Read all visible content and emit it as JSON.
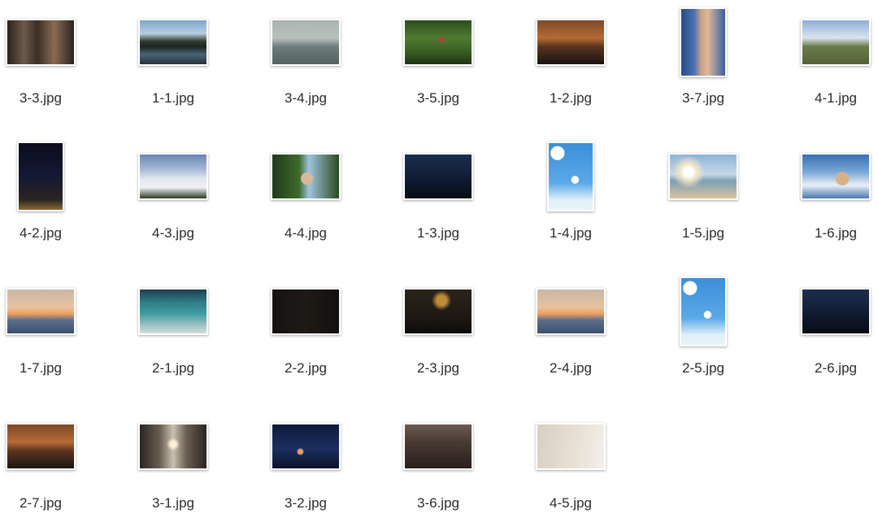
{
  "files": [
    {
      "name": "3-3.jpg",
      "icon": "photo-icon"
    },
    {
      "name": "1-1.jpg",
      "icon": "photo-icon"
    },
    {
      "name": "3-4.jpg",
      "icon": "photo-icon"
    },
    {
      "name": "3-5.jpg",
      "icon": "photo-icon"
    },
    {
      "name": "1-2.jpg",
      "icon": "photo-icon"
    },
    {
      "name": "3-7.jpg",
      "icon": "photo-icon"
    },
    {
      "name": "4-1.jpg",
      "icon": "photo-icon"
    },
    {
      "name": "4-2.jpg",
      "icon": "photo-icon"
    },
    {
      "name": "4-3.jpg",
      "icon": "photo-icon"
    },
    {
      "name": "4-4.jpg",
      "icon": "photo-icon"
    },
    {
      "name": "1-3.jpg",
      "icon": "photo-icon"
    },
    {
      "name": "1-4.jpg",
      "icon": "photo-icon"
    },
    {
      "name": "1-5.jpg",
      "icon": "photo-icon"
    },
    {
      "name": "1-6.jpg",
      "icon": "photo-icon"
    },
    {
      "name": "1-7.jpg",
      "icon": "photo-icon"
    },
    {
      "name": "2-1.jpg",
      "icon": "photo-icon"
    },
    {
      "name": "2-2.jpg",
      "icon": "photo-icon"
    },
    {
      "name": "2-3.jpg",
      "icon": "photo-icon"
    },
    {
      "name": "2-4.jpg",
      "icon": "photo-icon"
    },
    {
      "name": "2-5.jpg",
      "icon": "photo-icon"
    },
    {
      "name": "2-6.jpg",
      "icon": "photo-icon"
    },
    {
      "name": "2-7.jpg",
      "icon": "photo-icon"
    },
    {
      "name": "3-1.jpg",
      "icon": "photo-icon"
    },
    {
      "name": "3-2.jpg",
      "icon": "photo-icon"
    },
    {
      "name": "3-6.jpg",
      "icon": "photo-icon"
    },
    {
      "name": "4-5.jpg",
      "icon": "photo-icon"
    }
  ]
}
